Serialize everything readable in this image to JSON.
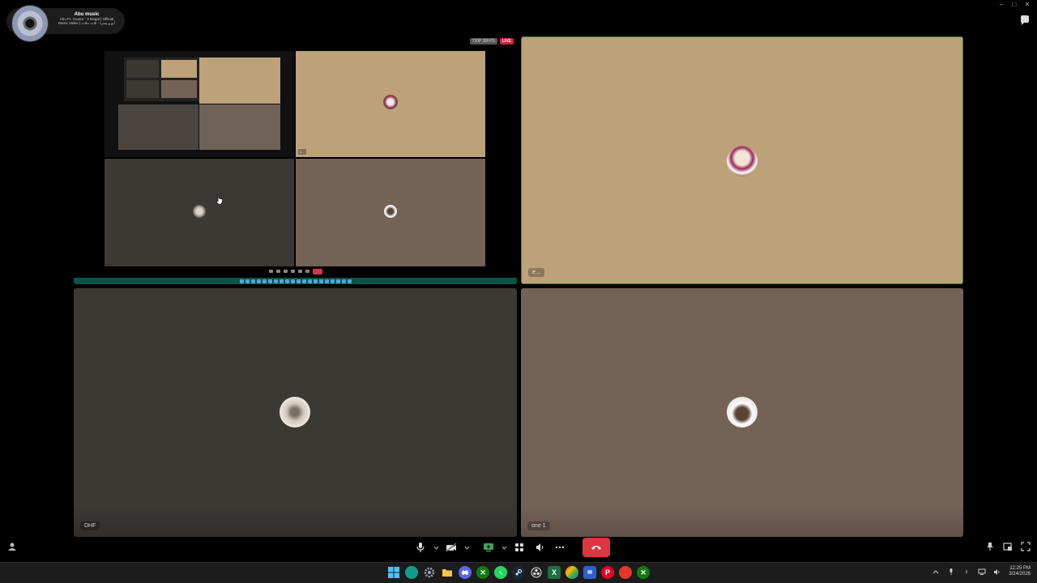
{
  "window": {
    "minimize": "–",
    "maximize": "□",
    "close": "✕"
  },
  "media": {
    "title": "Abu music",
    "subtitle_1": "Abu Ft. Yousra - 3 Daqat | Official",
    "subtitle_2": "Music Video | أبو و يسرا - تلات دقات"
  },
  "screen_share": {
    "resolution_badge": "720P 30FPS",
    "live_badge": "LIVE"
  },
  "tiles": {
    "user1": {
      "label": "e..."
    },
    "dhf": {
      "label": "DHF"
    },
    "one1": {
      "label": "one 1"
    }
  },
  "nested": {
    "label_a": "e..."
  },
  "taskbar": {
    "time": "12:25 PM",
    "date": "3/24/2026"
  },
  "colors": {
    "accent_green": "#4a7a3c",
    "end_call_red": "#da3743",
    "tile_tan": "#bca179",
    "tile_dark": "#3c3834",
    "tile_mauve": "#756257"
  }
}
